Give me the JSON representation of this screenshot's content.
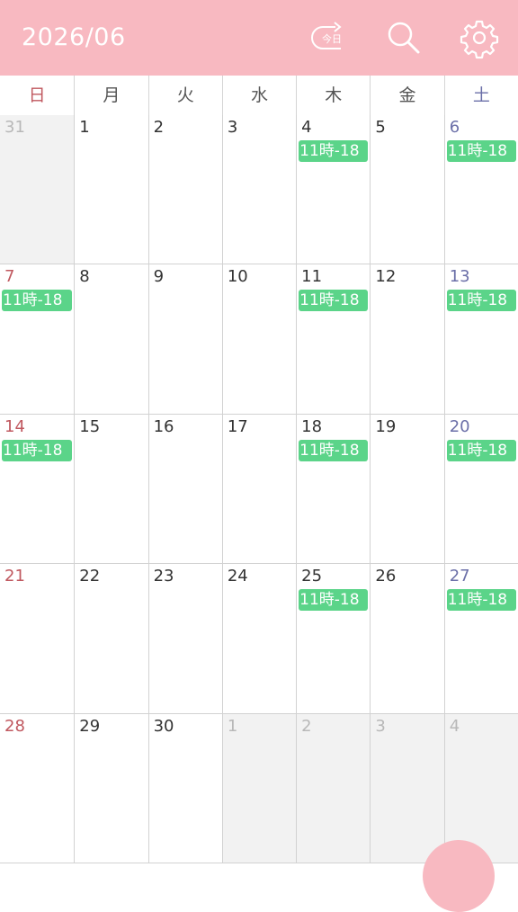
{
  "header": {
    "title": "2026/06",
    "today_icon_label": "今日",
    "today_icon": "today-icon",
    "search_icon": "search-icon",
    "settings_icon": "gear-icon",
    "color": "#f8b9c1"
  },
  "weekdays": [
    "日",
    "月",
    "火",
    "水",
    "木",
    "金",
    "土"
  ],
  "weeks": [
    [
      {
        "day": "31",
        "other": true
      },
      {
        "day": "1"
      },
      {
        "day": "2"
      },
      {
        "day": "3"
      },
      {
        "day": "4",
        "event": "11時-18"
      },
      {
        "day": "5"
      },
      {
        "day": "6",
        "event": "11時-18"
      }
    ],
    [
      {
        "day": "7",
        "event": "11時-18"
      },
      {
        "day": "8"
      },
      {
        "day": "9"
      },
      {
        "day": "10"
      },
      {
        "day": "11",
        "event": "11時-18"
      },
      {
        "day": "12"
      },
      {
        "day": "13",
        "event": "11時-18"
      }
    ],
    [
      {
        "day": "14",
        "event": "11時-18"
      },
      {
        "day": "15"
      },
      {
        "day": "16"
      },
      {
        "day": "17"
      },
      {
        "day": "18",
        "event": "11時-18"
      },
      {
        "day": "19"
      },
      {
        "day": "20",
        "event": "11時-18"
      }
    ],
    [
      {
        "day": "21"
      },
      {
        "day": "22"
      },
      {
        "day": "23"
      },
      {
        "day": "24"
      },
      {
        "day": "25",
        "event": "11時-18"
      },
      {
        "day": "26"
      },
      {
        "day": "27",
        "event": "11時-18"
      }
    ],
    [
      {
        "day": "28"
      },
      {
        "day": "29"
      },
      {
        "day": "30"
      },
      {
        "day": "1",
        "other": true
      },
      {
        "day": "2",
        "other": true
      },
      {
        "day": "3",
        "other": true
      },
      {
        "day": "4",
        "other": true
      }
    ]
  ],
  "colors": {
    "event": "#5bd489",
    "sunday": "#c0585f",
    "saturday": "#6b6fa8",
    "other_month_bg": "#f2f2f2"
  },
  "fab_icon": "add-event-button"
}
